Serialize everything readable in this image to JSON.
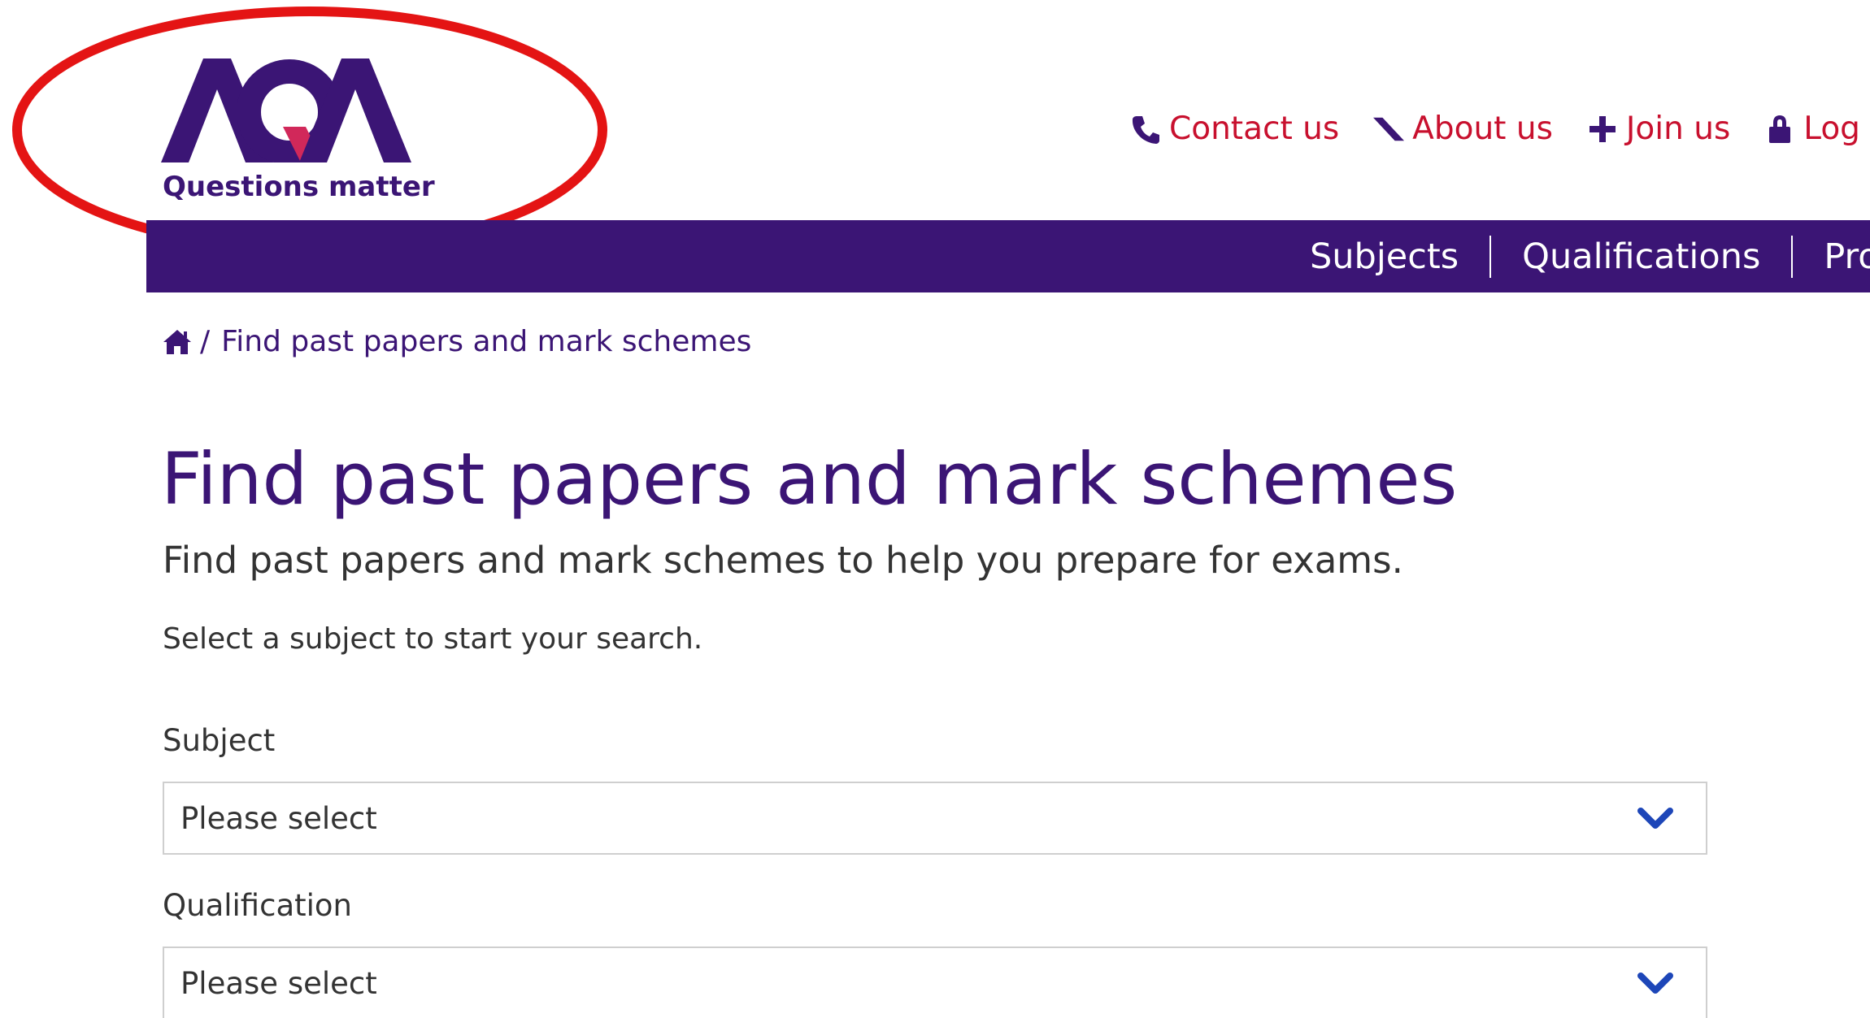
{
  "logo": {
    "wordmark": "AQA",
    "tagline": "Questions matter",
    "colors": {
      "purple": "#3b1575",
      "accent": "#d1285a"
    }
  },
  "annotation": {
    "shape": "ellipse",
    "color": "#e41414",
    "target": "logo"
  },
  "utility_nav": [
    {
      "label": "Contact us",
      "icon": "phone-icon"
    },
    {
      "label": "About us",
      "icon": "wedge-icon"
    },
    {
      "label": "Join us",
      "icon": "plus-icon"
    },
    {
      "label": "Log in",
      "icon": "lock-icon"
    }
  ],
  "main_nav": {
    "background": "#3b1575",
    "items": [
      "Subjects",
      "Qualifications",
      "Prof"
    ]
  },
  "breadcrumb": {
    "home_icon": "home-icon",
    "separator": "/",
    "current": "Find past papers and mark schemes"
  },
  "page": {
    "title": "Find past papers and mark schemes",
    "subtitle": "Find past papers and mark schemes to help you prepare for exams.",
    "intro": "Select a subject to start your search."
  },
  "form": {
    "subject": {
      "label": "Subject",
      "value": "Please select"
    },
    "qualification": {
      "label": "Qualification",
      "value": "Please select"
    },
    "chevron_icon": "chevron-down-icon",
    "chevron_color": "#1d46b8"
  },
  "colors": {
    "brand_purple": "#3b1575",
    "link_red": "#c8102e",
    "text": "#333333"
  }
}
